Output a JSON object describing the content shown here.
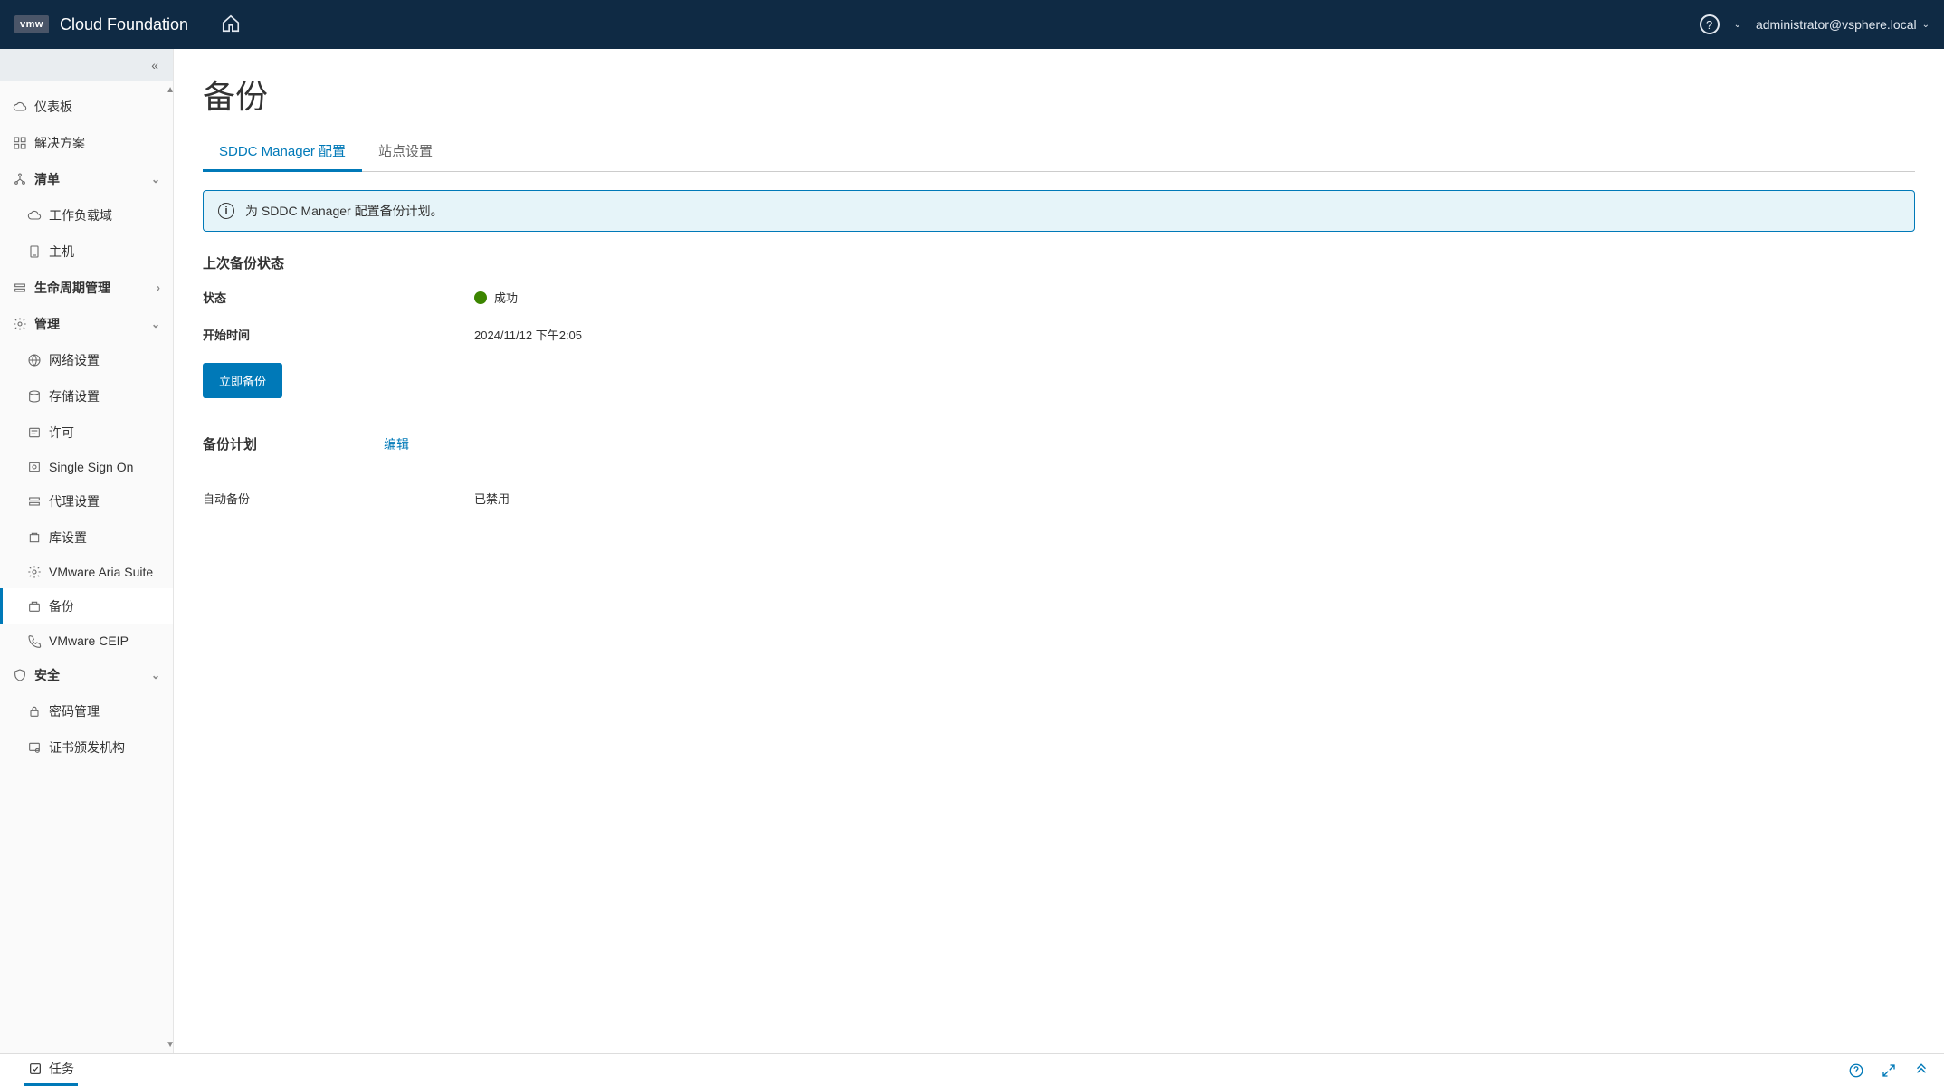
{
  "header": {
    "logo_text": "vmw",
    "brand": "Cloud Foundation",
    "user": "administrator@vsphere.local"
  },
  "sidebar": {
    "items": [
      {
        "label": "仪表板",
        "type": "item"
      },
      {
        "label": "解决方案",
        "type": "item"
      },
      {
        "label": "清单",
        "type": "group",
        "expanded": true
      },
      {
        "label": "工作负载域",
        "type": "sub"
      },
      {
        "label": "主机",
        "type": "sub"
      },
      {
        "label": "生命周期管理",
        "type": "group",
        "expanded": false
      },
      {
        "label": "管理",
        "type": "group",
        "expanded": true
      },
      {
        "label": "网络设置",
        "type": "sub"
      },
      {
        "label": "存储设置",
        "type": "sub"
      },
      {
        "label": "许可",
        "type": "sub"
      },
      {
        "label": "Single Sign On",
        "type": "sub"
      },
      {
        "label": "代理设置",
        "type": "sub"
      },
      {
        "label": "库设置",
        "type": "sub"
      },
      {
        "label": "VMware Aria Suite",
        "type": "sub"
      },
      {
        "label": "备份",
        "type": "sub",
        "active": true
      },
      {
        "label": "VMware CEIP",
        "type": "sub"
      },
      {
        "label": "安全",
        "type": "group",
        "expanded": true
      },
      {
        "label": "密码管理",
        "type": "sub"
      },
      {
        "label": "证书颁发机构",
        "type": "sub"
      }
    ]
  },
  "main": {
    "title": "备份",
    "tabs": [
      {
        "label": "SDDC Manager 配置",
        "active": true
      },
      {
        "label": "站点设置",
        "active": false
      }
    ],
    "banner": "为 SDDC Manager 配置备份计划。",
    "last_backup_heading": "上次备份状态",
    "status_label": "状态",
    "status_value": "成功",
    "start_label": "开始时间",
    "start_value": "2024/11/12 下午2:05",
    "backup_now_btn": "立即备份",
    "plan_heading": "备份计划",
    "edit_label": "编辑",
    "auto_backup_label": "自动备份",
    "auto_backup_value": "已禁用"
  },
  "footer": {
    "tasks_label": "任务"
  }
}
